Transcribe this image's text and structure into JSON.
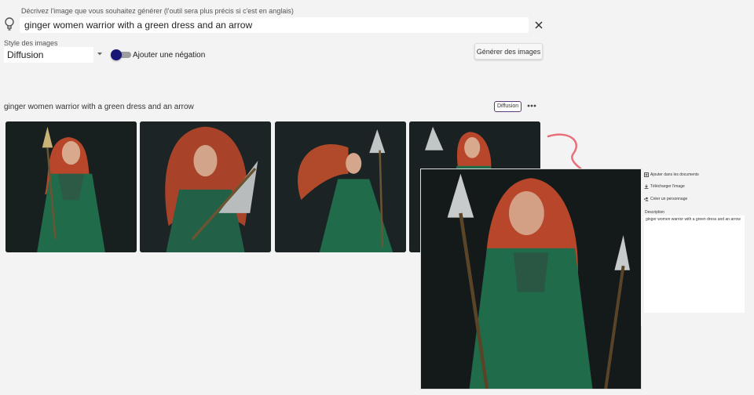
{
  "prompt": {
    "label": "Décrivez l'image que vous souhaitez générer (l'outil sera plus précis si c'est en anglais)",
    "value": "ginger women warrior with a green dress and an arrow"
  },
  "style": {
    "label": "Style des images",
    "selected": "Diffusion"
  },
  "negation": {
    "label": "Ajouter une négation",
    "on": true
  },
  "generate_button": "Générer des images",
  "result": {
    "title": "ginger women warrior with a green dress and an arrow",
    "badge": "Diffusion"
  },
  "panel": {
    "actions": [
      "Ajouter dans les documents",
      "Télécharger l'image",
      "Créer un personnage"
    ],
    "description_label": "Description",
    "description_value": "ginger women warrior with a green dress and an arrow"
  },
  "colors": {
    "accent": "#1a1675",
    "arrow": "#e9707a",
    "dress": "#1f6b4a",
    "hair": "#b8462a"
  }
}
